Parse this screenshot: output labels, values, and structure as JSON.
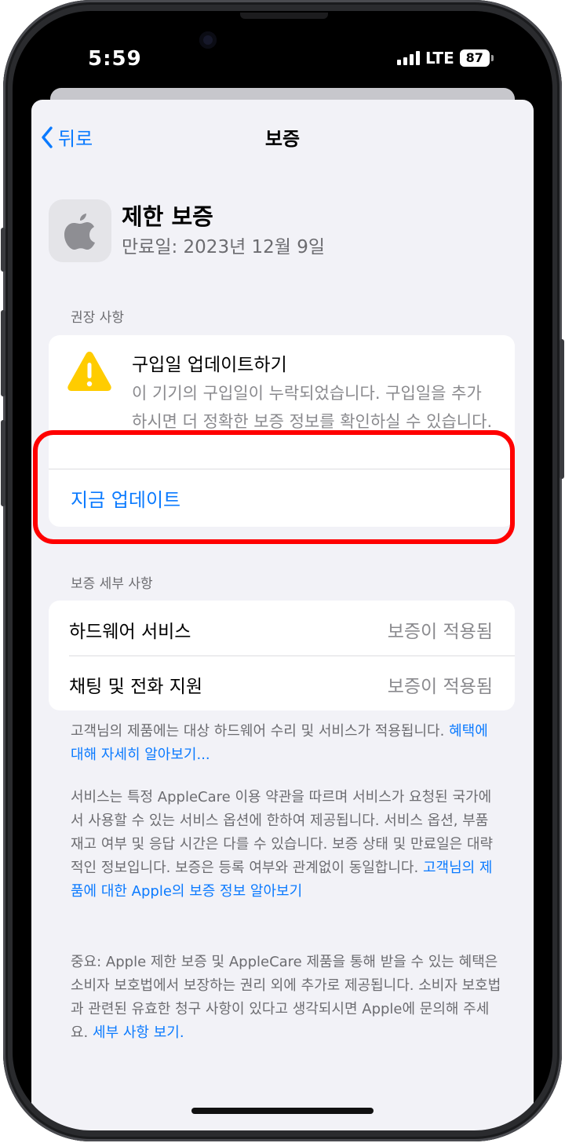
{
  "status_bar": {
    "time": "5:59",
    "network": "LTE",
    "battery": "87"
  },
  "nav": {
    "back_label": "뒤로",
    "title": "보증"
  },
  "header": {
    "title": "제한 보증",
    "subtitle": "만료일: 2023년 12월 9일"
  },
  "recommendations": {
    "section_label": "권장 사항",
    "title": "구입일 업데이트하기",
    "body": "이 기기의 구입일이 누락되었습니다. 구입일을 추가하시면 더 정확한 보증 정보를 확인하실 수 있습니다.",
    "action": "지금 업데이트"
  },
  "details": {
    "section_label": "보증 세부 사항",
    "rows": [
      {
        "label": "하드웨어 서비스",
        "value": "보증이 적용됨"
      },
      {
        "label": "채팅 및 전화 지원",
        "value": "보증이 적용됨"
      }
    ]
  },
  "footer": {
    "p1": "고객님의 제품에는 대상 하드웨어 수리 및 서비스가 적용됩니다.",
    "p1_link": "혜택에 대해 자세히 알아보기...",
    "p2": "서비스는 특정 AppleCare 이용 약관을 따르며 서비스가 요청된 국가에서 사용할 수 있는 서비스 옵션에 한하여 제공됩니다. 서비스 옵션, 부품 재고 여부 및 응답 시간은 다를 수 있습니다. 보증 상태 및 만료일은 대략적인 정보입니다. 보증은 등록 여부와 관계없이 동일합니다.",
    "p2_link": "고객님의 제품에 대한 Apple의 보증 정보 알아보기",
    "p3": "중요: Apple 제한 보증 및 AppleCare 제품을 통해 받을 수 있는 혜택은 소비자 보호법에서 보장하는 권리 외에 추가로 제공됩니다. 소비자 보호법과 관련된 유효한 청구 사항이 있다고 생각되시면 Apple에 문의해 주세요.",
    "p3_link": "세부 사항 보기."
  },
  "colors": {
    "accent": "#0a7aff",
    "warning": "#ffcc00",
    "highlight": "#ff0000",
    "background": "#f2f2f7"
  },
  "icons": [
    "chevron-left-icon",
    "apple-logo-icon",
    "warning-triangle-icon",
    "signal-icon",
    "battery-icon"
  ]
}
